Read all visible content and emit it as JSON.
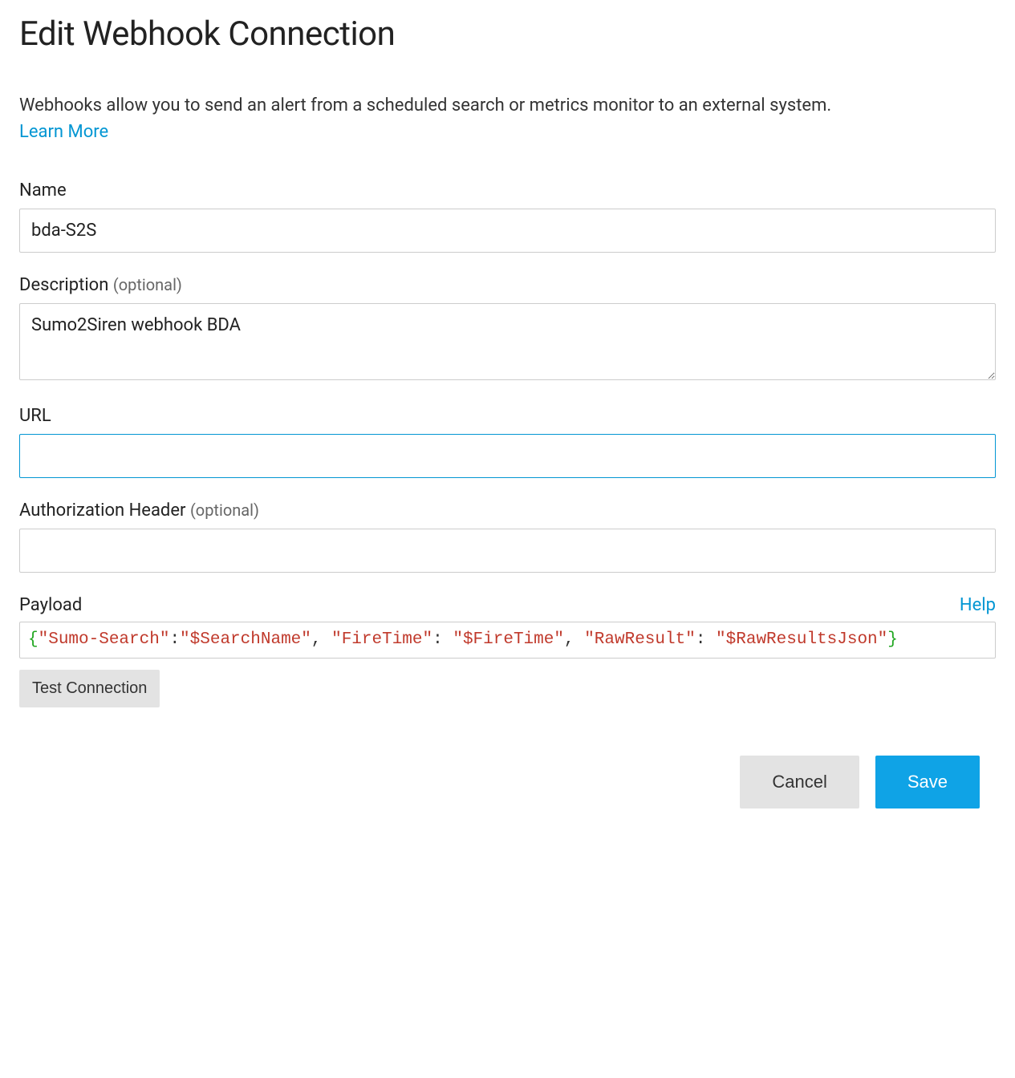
{
  "title": "Edit Webhook Connection",
  "intro": "Webhooks allow you to send an alert from a scheduled search or metrics monitor to an external system.",
  "learn_more_label": "Learn More",
  "fields": {
    "name": {
      "label": "Name",
      "value": "bda-S2S"
    },
    "description": {
      "label": "Description",
      "optional": "(optional)",
      "value": "Sumo2Siren webhook BDA"
    },
    "url": {
      "label": "URL",
      "value": ""
    },
    "auth_header": {
      "label": "Authorization Header",
      "optional": "(optional)",
      "value": ""
    },
    "payload": {
      "label": "Payload",
      "help_label": "Help"
    }
  },
  "payload_tokens": [
    {
      "cls": "tok-brace",
      "t": "{"
    },
    {
      "cls": "tok-str",
      "t": "\"Sumo-Search\""
    },
    {
      "cls": "tok-punct",
      "t": ":"
    },
    {
      "cls": "tok-str",
      "t": "\"$SearchName\""
    },
    {
      "cls": "tok-punct",
      "t": ", "
    },
    {
      "cls": "tok-str",
      "t": "\"FireTime\""
    },
    {
      "cls": "tok-punct",
      "t": ": "
    },
    {
      "cls": "tok-str",
      "t": "\"$FireTime\""
    },
    {
      "cls": "tok-punct",
      "t": ", "
    },
    {
      "cls": "tok-str",
      "t": "\"RawResult\""
    },
    {
      "cls": "tok-punct",
      "t": ": "
    },
    {
      "cls": "tok-str",
      "t": "\"$RawResultsJson\""
    },
    {
      "cls": "tok-brace",
      "t": "}"
    }
  ],
  "buttons": {
    "test_connection": "Test Connection",
    "cancel": "Cancel",
    "save": "Save"
  }
}
